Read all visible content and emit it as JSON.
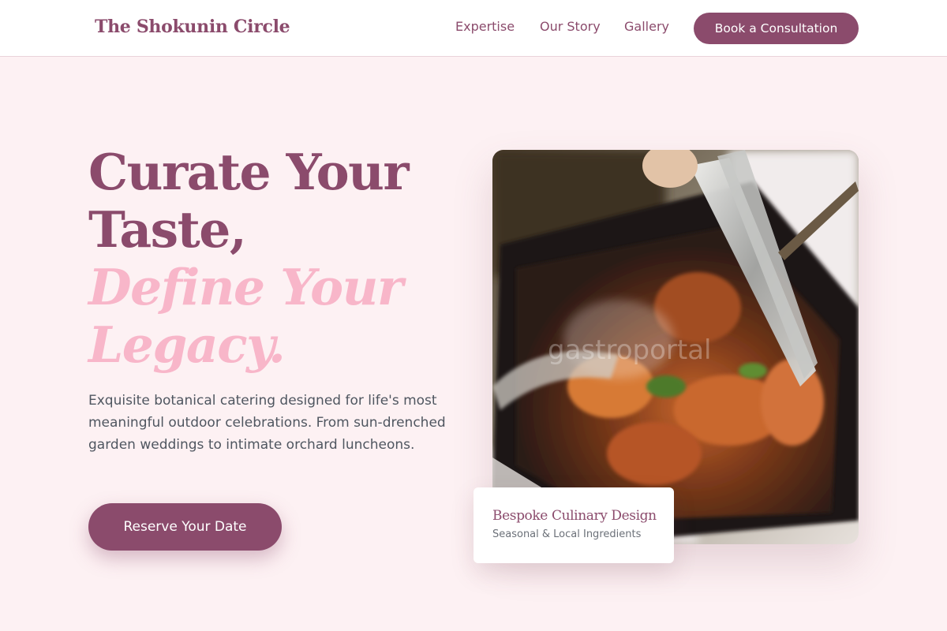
{
  "brand": {
    "name": "The Shokunin Circle"
  },
  "nav": {
    "links": [
      "Expertise",
      "Our Story",
      "Gallery"
    ],
    "cta_label": "Book a Consultation"
  },
  "hero": {
    "headline_lines": [
      "Curate Your",
      "Taste,"
    ],
    "accent_lines": [
      "Define Your",
      "Legacy."
    ],
    "description": "Exquisite botanical catering designed for life's most meaningful outdoor celebrations. From sun-drenched garden weddings to intimate orchard luncheons.",
    "cta_label": "Reserve Your Date",
    "image": {
      "watermark": "gastroportal"
    }
  },
  "card": {
    "title": "Bespoke Culinary Design",
    "subtitle": "Seasonal & Local Ingredients"
  },
  "colors": {
    "brand": "#8b4b6c",
    "accent_pink": "#f8b6c9",
    "background": "#fdf1f3",
    "body_text": "#4f5660"
  }
}
